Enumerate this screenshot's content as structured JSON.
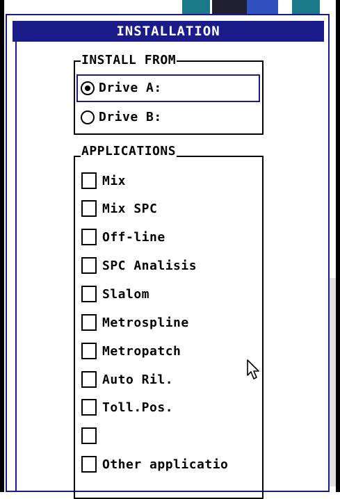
{
  "dialog": {
    "title": "INSTALLATION"
  },
  "install_from": {
    "label": "INSTALL FROM",
    "selected": "Drive A:",
    "options": [
      {
        "label": "Drive A:",
        "selected": true
      },
      {
        "label": "Drive B:",
        "selected": false
      }
    ]
  },
  "applications": {
    "label": "APPLICATIONS",
    "items": [
      {
        "label": "Mix",
        "checked": false
      },
      {
        "label": "Mix SPC",
        "checked": false
      },
      {
        "label": "Off-line",
        "checked": false
      },
      {
        "label": "SPC Analisis",
        "checked": false
      },
      {
        "label": "Slalom",
        "checked": false
      },
      {
        "label": "Metrospline",
        "checked": false
      },
      {
        "label": "Metropatch",
        "checked": false
      },
      {
        "label": "Auto Ril.",
        "checked": false
      },
      {
        "label": "Toll.Pos.",
        "checked": false
      },
      {
        "label": "",
        "checked": false
      },
      {
        "label": "Other applicatio",
        "checked": false
      }
    ]
  },
  "colors": {
    "title_bar": "#1b1b8a",
    "text": "#000000",
    "background": "#ffffff"
  },
  "icons": {
    "pointer": "mouse-pointer-icon",
    "radio_selected": "radio-selected-icon"
  }
}
